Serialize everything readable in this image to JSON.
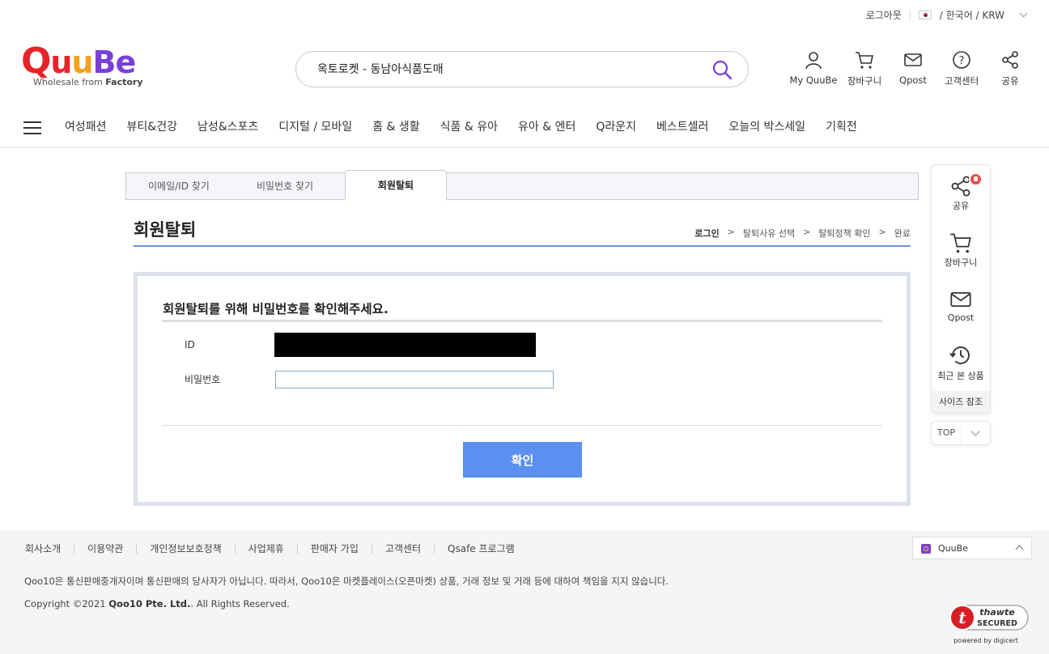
{
  "util": {
    "logout": "로그아웃",
    "locale": "/ 한국어 / KRW"
  },
  "logo": {
    "tagline_pre": "Wholesale from ",
    "tagline_bold": "Factory"
  },
  "search": {
    "value": "옥토로켓 - 동남아식품도매"
  },
  "header_icons": [
    {
      "label": "My QuuBe",
      "icon": "user-icon"
    },
    {
      "label": "장바구니",
      "icon": "cart-icon"
    },
    {
      "label": "Qpost",
      "icon": "mail-icon"
    },
    {
      "label": "고객센터",
      "icon": "help-icon"
    },
    {
      "label": "공유",
      "icon": "share-icon"
    }
  ],
  "nav": {
    "items": [
      "여성패션",
      "뷰티&건강",
      "남성&스포츠",
      "디지털 / 모바일",
      "홈 & 생활",
      "식품 & 유아",
      "유아 & 엔터",
      "Q라운지",
      "베스트셀러",
      "오늘의 박스세일",
      "기획전"
    ]
  },
  "tabs": [
    {
      "label": "이메일/ID 찾기"
    },
    {
      "label": "비밀번호 찾기"
    },
    {
      "label": "회원탈퇴",
      "active": true
    }
  ],
  "page": {
    "title": "회원탈퇴",
    "steps": [
      "로그인",
      "탈퇴사유 선택",
      "탈퇴정책 확인",
      "완료"
    ],
    "step_sep": ">"
  },
  "form": {
    "heading": "회원탈퇴를 위해 비밀번호를 확인해주세요.",
    "id_label": "ID",
    "password_label": "비밀번호",
    "password_value": "",
    "confirm_label": "확인"
  },
  "side": {
    "share": "공유",
    "cart": "장바구니",
    "qpost": "Qpost",
    "recent": "최근 본 상품",
    "size": "사이즈 참조",
    "top": "TOP"
  },
  "footer": {
    "links": [
      "회사소개",
      "이용약관",
      "개인정보보호정책",
      "사업제휴",
      "판매자 가입",
      "고객센터",
      "Qsafe 프로그램"
    ],
    "site_select": "QuuBe",
    "notice": "Qoo10은 통신판매중개자이며 통신판매의 당사자가 아닙니다. 따라서, Qoo10은 마켓플레이스(오픈마켓) 상품, 거래 정보 및 거래 등에 대하여 책임을 지지 않습니다.",
    "copyright_pre": "Copyright ©2021 ",
    "copyright_bold": "Qoo10 Pte. Ltd.",
    "copyright_post": ". All Rights Reserved."
  },
  "seal": {
    "brand": "thawte",
    "status": "SECURED",
    "powered": "powered by digicert"
  },
  "colors": {
    "accent": "#5b8ff0",
    "logo_red": "#e8232a",
    "logo_orange": "#f0a31b",
    "logo_purple": "#7b3fd6",
    "title_line": "#6e94d9"
  }
}
